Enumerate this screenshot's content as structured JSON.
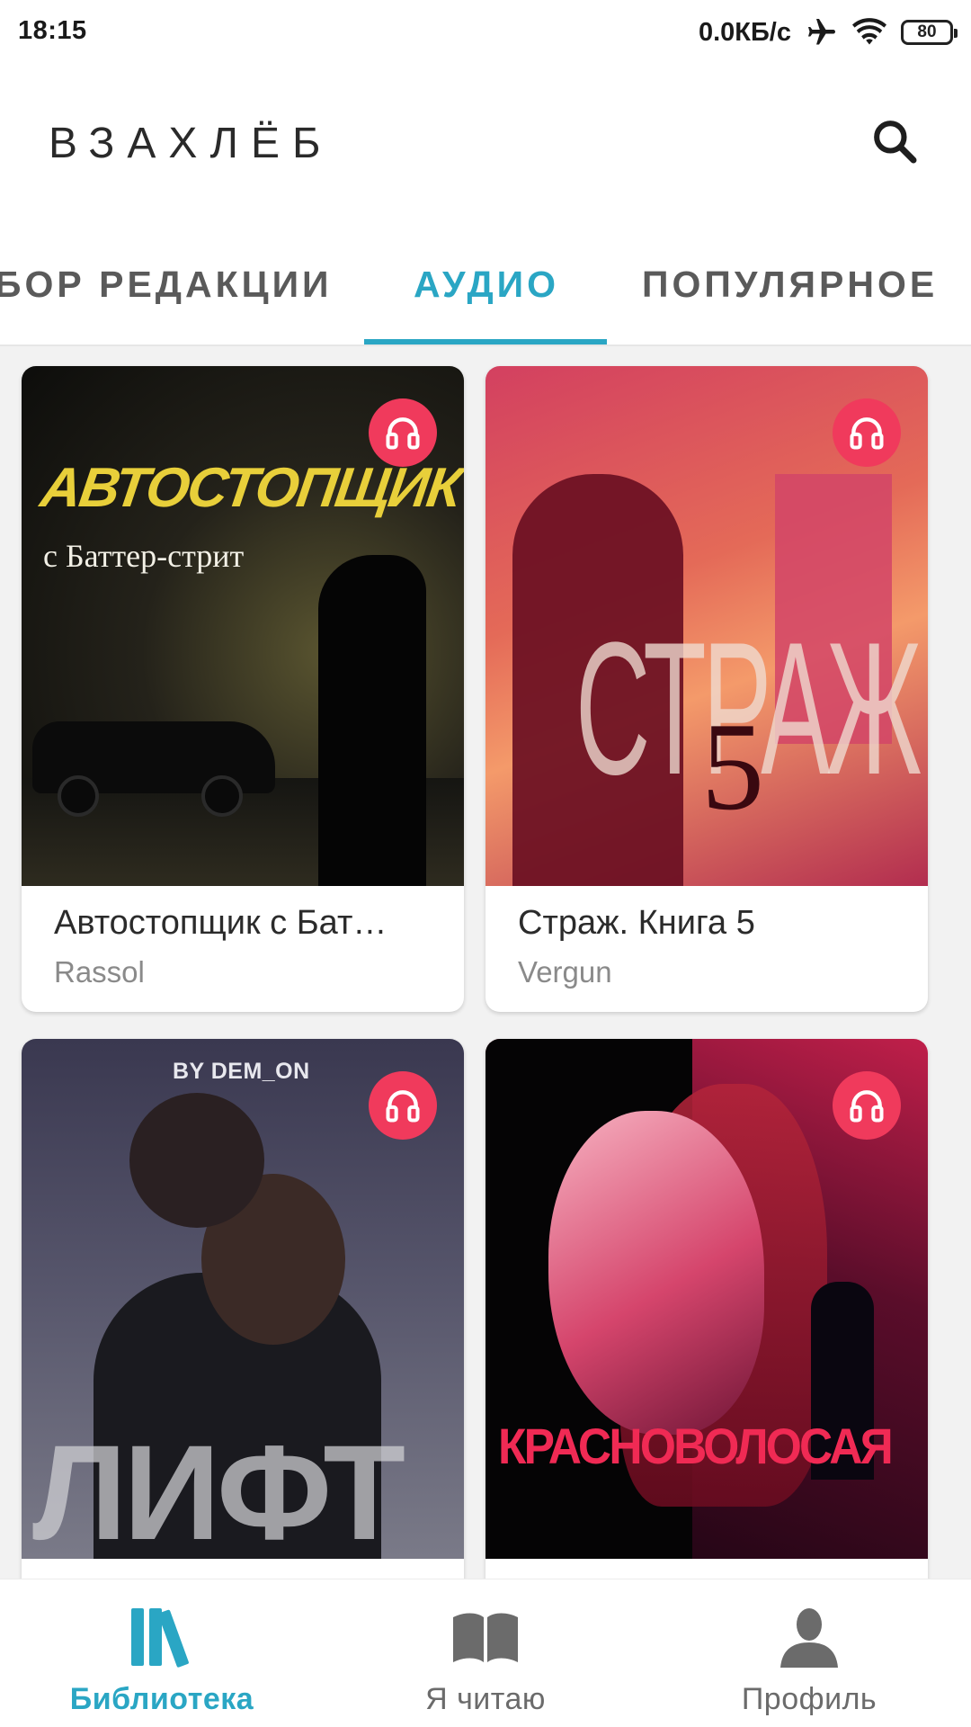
{
  "status_bar": {
    "time": "18:15",
    "net_speed": "0.0КБ/с",
    "battery": "80",
    "icons": [
      "airplane-icon",
      "wifi-icon",
      "battery-icon"
    ]
  },
  "app": {
    "title": "ВЗАХЛЁБ",
    "search_icon": "search-icon"
  },
  "tabs": [
    {
      "label": "БОР РЕДАКЦИИ",
      "active": false
    },
    {
      "label": "АУДИО",
      "active": true
    },
    {
      "label": "ПОПУЛЯРНОЕ",
      "active": false
    }
  ],
  "books": [
    {
      "title": "Автостопщик с Бат…",
      "author": "Rassol",
      "cover_title": "АВТОСТОПЩИК",
      "cover_subtitle": "с Баттер-стрит",
      "audio": true
    },
    {
      "title": "Страж. Книга 5",
      "author": "Vergun",
      "cover_title": "СТРАЖ",
      "cover_number": "5",
      "audio": true
    },
    {
      "title": "",
      "author": "",
      "cover_byline": "BY DEM_ON",
      "cover_title": "ЛИФТ",
      "audio": true
    },
    {
      "title": "",
      "author": "",
      "cover_title": "КРАСНОВОЛОСАЯ",
      "audio": true
    }
  ],
  "bottom_nav": [
    {
      "label": "Библиотека",
      "icon": "library-icon",
      "active": true
    },
    {
      "label": "Я читаю",
      "icon": "open-book-icon",
      "active": false
    },
    {
      "label": "Профиль",
      "icon": "profile-icon",
      "active": false
    }
  ],
  "colors": {
    "accent": "#2aa6c4",
    "audio_badge": "#f03a5c",
    "background": "#f2f2f2"
  }
}
